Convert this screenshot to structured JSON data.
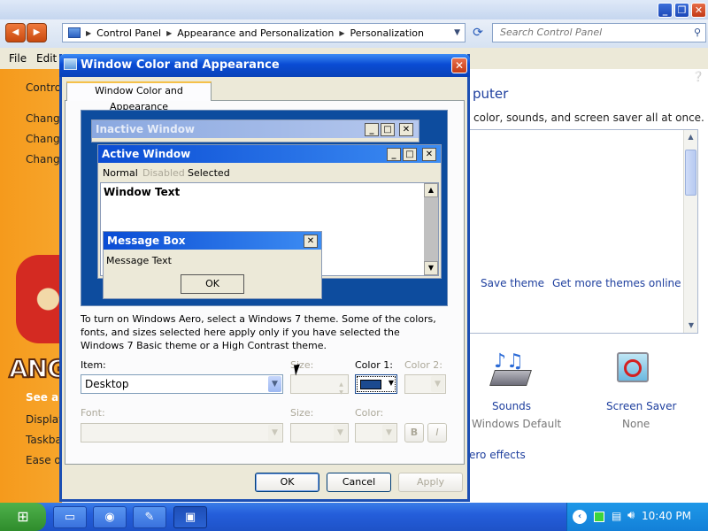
{
  "explorer": {
    "breadcrumbs": [
      "Control Panel",
      "Appearance and Personalization",
      "Personalization"
    ],
    "search_placeholder": "Search Control Panel",
    "menu": [
      "File",
      "Edit"
    ],
    "sidebar_links": [
      "Contro",
      "Change",
      "Change",
      "Change",
      "See als",
      "Display",
      "Taskba",
      "Ease of"
    ],
    "game_text": "ANG",
    "main_heading": "puter",
    "main_subtext": "color, sounds, and screen saver all at once.",
    "save_theme": "Save theme",
    "get_more_themes": "Get more themes online",
    "sounds_label": "Sounds",
    "sounds_value": "Windows Default",
    "screensaver_label": "Screen Saver",
    "screensaver_value": "None",
    "aero_link": "ero effects"
  },
  "dialog": {
    "title": "Window Color and Appearance",
    "tab": "Window Color and Appearance",
    "preview": {
      "inactive_title": "Inactive Window",
      "active_title": "Active Window",
      "menu_normal": "Normal",
      "menu_disabled": "Disabled",
      "menu_selected": "Selected",
      "window_text": "Window Text",
      "msgbox_title": "Message Box",
      "msgbox_text": "Message Text",
      "msgbox_ok": "OK"
    },
    "info_text": "To turn on Windows Aero, select a Windows 7 theme.  Some of the colors, fonts, and sizes selected here apply only if you have selected the Windows 7 Basic theme or a High Contrast theme.",
    "item_label": "Item:",
    "item_value": "Desktop",
    "size_label": "Size:",
    "color1_label": "Color 1:",
    "color1_value": "#1b4a8f",
    "color2_label": "Color 2:",
    "font_label": "Font:",
    "font_size_label": "Size:",
    "font_color_label": "Color:",
    "bold_label": "B",
    "italic_label": "I",
    "ok": "OK",
    "cancel": "Cancel",
    "apply": "Apply"
  },
  "taskbar": {
    "time": "10:40 PM"
  }
}
